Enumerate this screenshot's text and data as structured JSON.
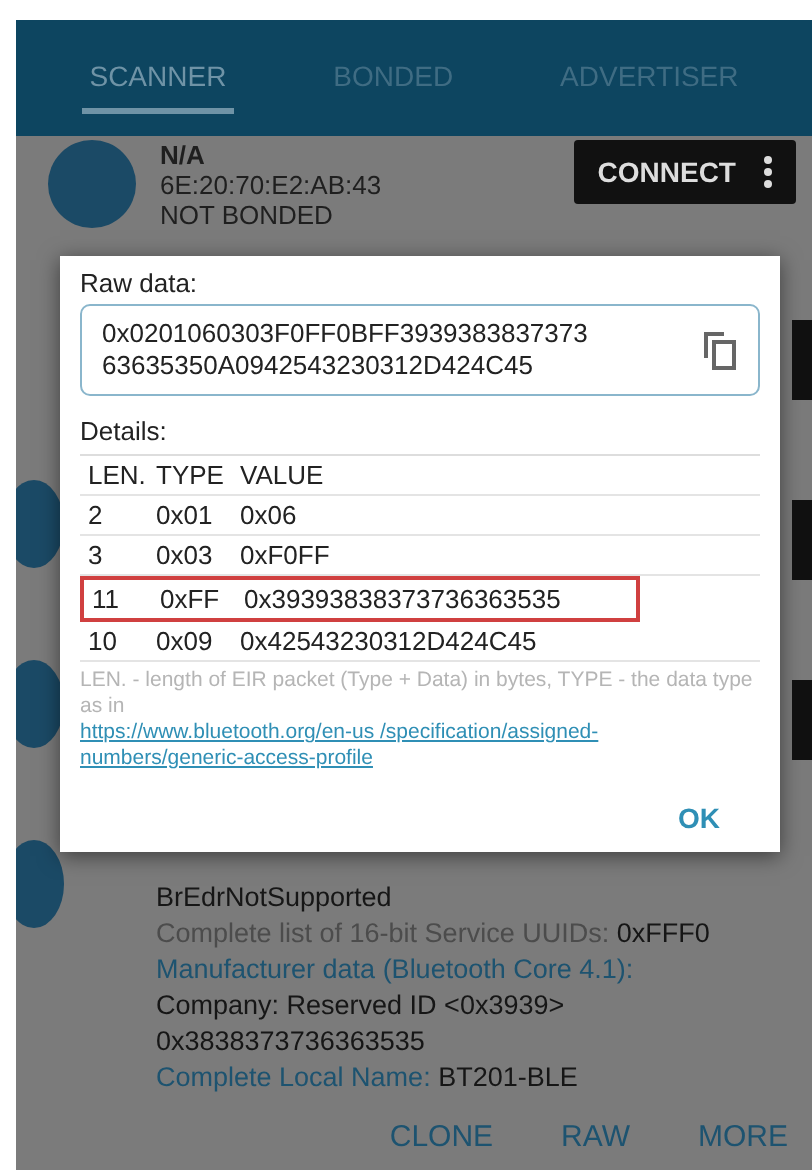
{
  "tabs": [
    {
      "label": "SCANNER",
      "selected": true
    },
    {
      "label": "BONDED",
      "selected": false
    },
    {
      "label": "ADVERTISER",
      "selected": false
    }
  ],
  "device": {
    "name": "N/A",
    "address": "6E:20:70:E2:AB:43",
    "bond_state": "NOT BONDED",
    "connect_button": "CONNECT"
  },
  "dialog": {
    "raw_data_label": "Raw data:",
    "raw_data": "0x0201060303F0FF0BFF3939383837373 63635350A0942543230312D424C45",
    "details_label": "Details:",
    "columns": [
      "LEN.",
      "TYPE",
      "VALUE"
    ],
    "rows": [
      {
        "len": "2",
        "type": "0x01",
        "value": "0x06",
        "highlighted": false
      },
      {
        "len": "3",
        "type": "0x03",
        "value": "0xF0FF",
        "highlighted": false
      },
      {
        "len": "11",
        "type": "0xFF",
        "value": "0x39393838373736363535",
        "highlighted": true
      },
      {
        "len": "10",
        "type": "0x09",
        "value": "0x42543230312D424C45",
        "highlighted": false
      }
    ],
    "legend": "LEN. - length of EIR packet (Type + Data) in bytes, TYPE - the data type as in ",
    "legend_link": "https://www.bluetooth.org/en-us /specification/assigned-numbers/generic-access-profile",
    "ok_button": "OK"
  },
  "details": [
    {
      "kind": "plain",
      "text": "BrEdrNotSupported"
    },
    {
      "kind": "pair",
      "label": "Complete list of 16-bit Service UUIDs:",
      "value": "0xFFF0"
    },
    {
      "kind": "heading",
      "text": "Manufacturer data (Bluetooth Core 4.1):"
    },
    {
      "kind": "plain",
      "text": "Company: Reserved ID <0x3939>"
    },
    {
      "kind": "plain",
      "text": "0x3838373736363535"
    },
    {
      "kind": "pair",
      "label": "Complete Local Name:",
      "value": "BT201-BLE"
    }
  ],
  "actions": [
    "CLONE",
    "RAW",
    "MORE"
  ]
}
